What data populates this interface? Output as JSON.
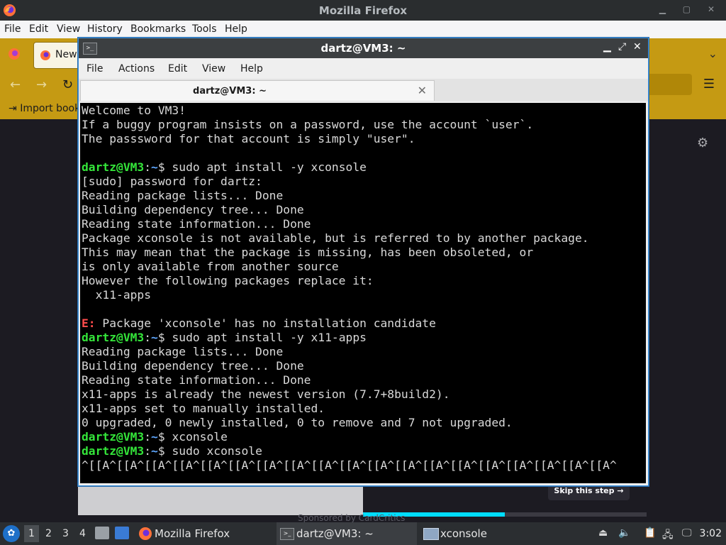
{
  "firefox": {
    "window_title": "Mozilla Firefox",
    "menu": [
      "File",
      "Edit",
      "View",
      "History",
      "Bookmarks",
      "Tools",
      "Help"
    ],
    "tab_label": "New",
    "bookmark_item": "Import book",
    "skip_button": "Skip this step →",
    "sponsor_text": "Sponsored by CardCritics",
    "onboarding_progress": 0.5
  },
  "terminal": {
    "window_title": "dartz@VM3: ~",
    "menu": [
      "File",
      "Actions",
      "Edit",
      "View",
      "Help"
    ],
    "tab_label": "dartz@VM3: ~",
    "prompt_user": "dartz@VM3",
    "prompt_path": "~",
    "lines": [
      {
        "kind": "out",
        "text": "Welcome to VM3!"
      },
      {
        "kind": "out",
        "text": "If a buggy program insists on a password, use the account `user`."
      },
      {
        "kind": "out",
        "text": "The passsword for that account is simply \"user\"."
      },
      {
        "kind": "out",
        "text": ""
      },
      {
        "kind": "cmd",
        "text": "sudo apt install -y xconsole"
      },
      {
        "kind": "out",
        "text": "[sudo] password for dartz:"
      },
      {
        "kind": "out",
        "text": "Reading package lists... Done"
      },
      {
        "kind": "out",
        "text": "Building dependency tree... Done"
      },
      {
        "kind": "out",
        "text": "Reading state information... Done"
      },
      {
        "kind": "out",
        "text": "Package xconsole is not available, but is referred to by another package."
      },
      {
        "kind": "out",
        "text": "This may mean that the package is missing, has been obsoleted, or"
      },
      {
        "kind": "out",
        "text": "is only available from another source"
      },
      {
        "kind": "out",
        "text": "However the following packages replace it:"
      },
      {
        "kind": "out",
        "text": "  x11-apps"
      },
      {
        "kind": "out",
        "text": ""
      },
      {
        "kind": "err",
        "prefix": "E:",
        "text": " Package 'xconsole' has no installation candidate"
      },
      {
        "kind": "cmd",
        "text": "sudo apt install -y x11-apps"
      },
      {
        "kind": "out",
        "text": "Reading package lists... Done"
      },
      {
        "kind": "out",
        "text": "Building dependency tree... Done"
      },
      {
        "kind": "out",
        "text": "Reading state information... Done"
      },
      {
        "kind": "out",
        "text": "x11-apps is already the newest version (7.7+8build2)."
      },
      {
        "kind": "out",
        "text": "x11-apps set to manually installed."
      },
      {
        "kind": "out",
        "text": "0 upgraded, 0 newly installed, 0 to remove and 7 not upgraded."
      },
      {
        "kind": "cmd",
        "text": "xconsole"
      },
      {
        "kind": "cmd",
        "text": "sudo xconsole"
      },
      {
        "kind": "out",
        "text": "^[[A^[[A^[[A^[[A^[[A^[[A^[[A^[[A^[[A^[[A^[[A^[[A^[[A^[[A^[[A^[[A^[[A^[[A^[[A^"
      }
    ]
  },
  "taskbar": {
    "workspaces": [
      "1",
      "2",
      "3",
      "4"
    ],
    "tasks": [
      "Mozilla Firefox",
      "dartz@VM3: ~",
      "xconsole"
    ],
    "clock": "3:02"
  }
}
